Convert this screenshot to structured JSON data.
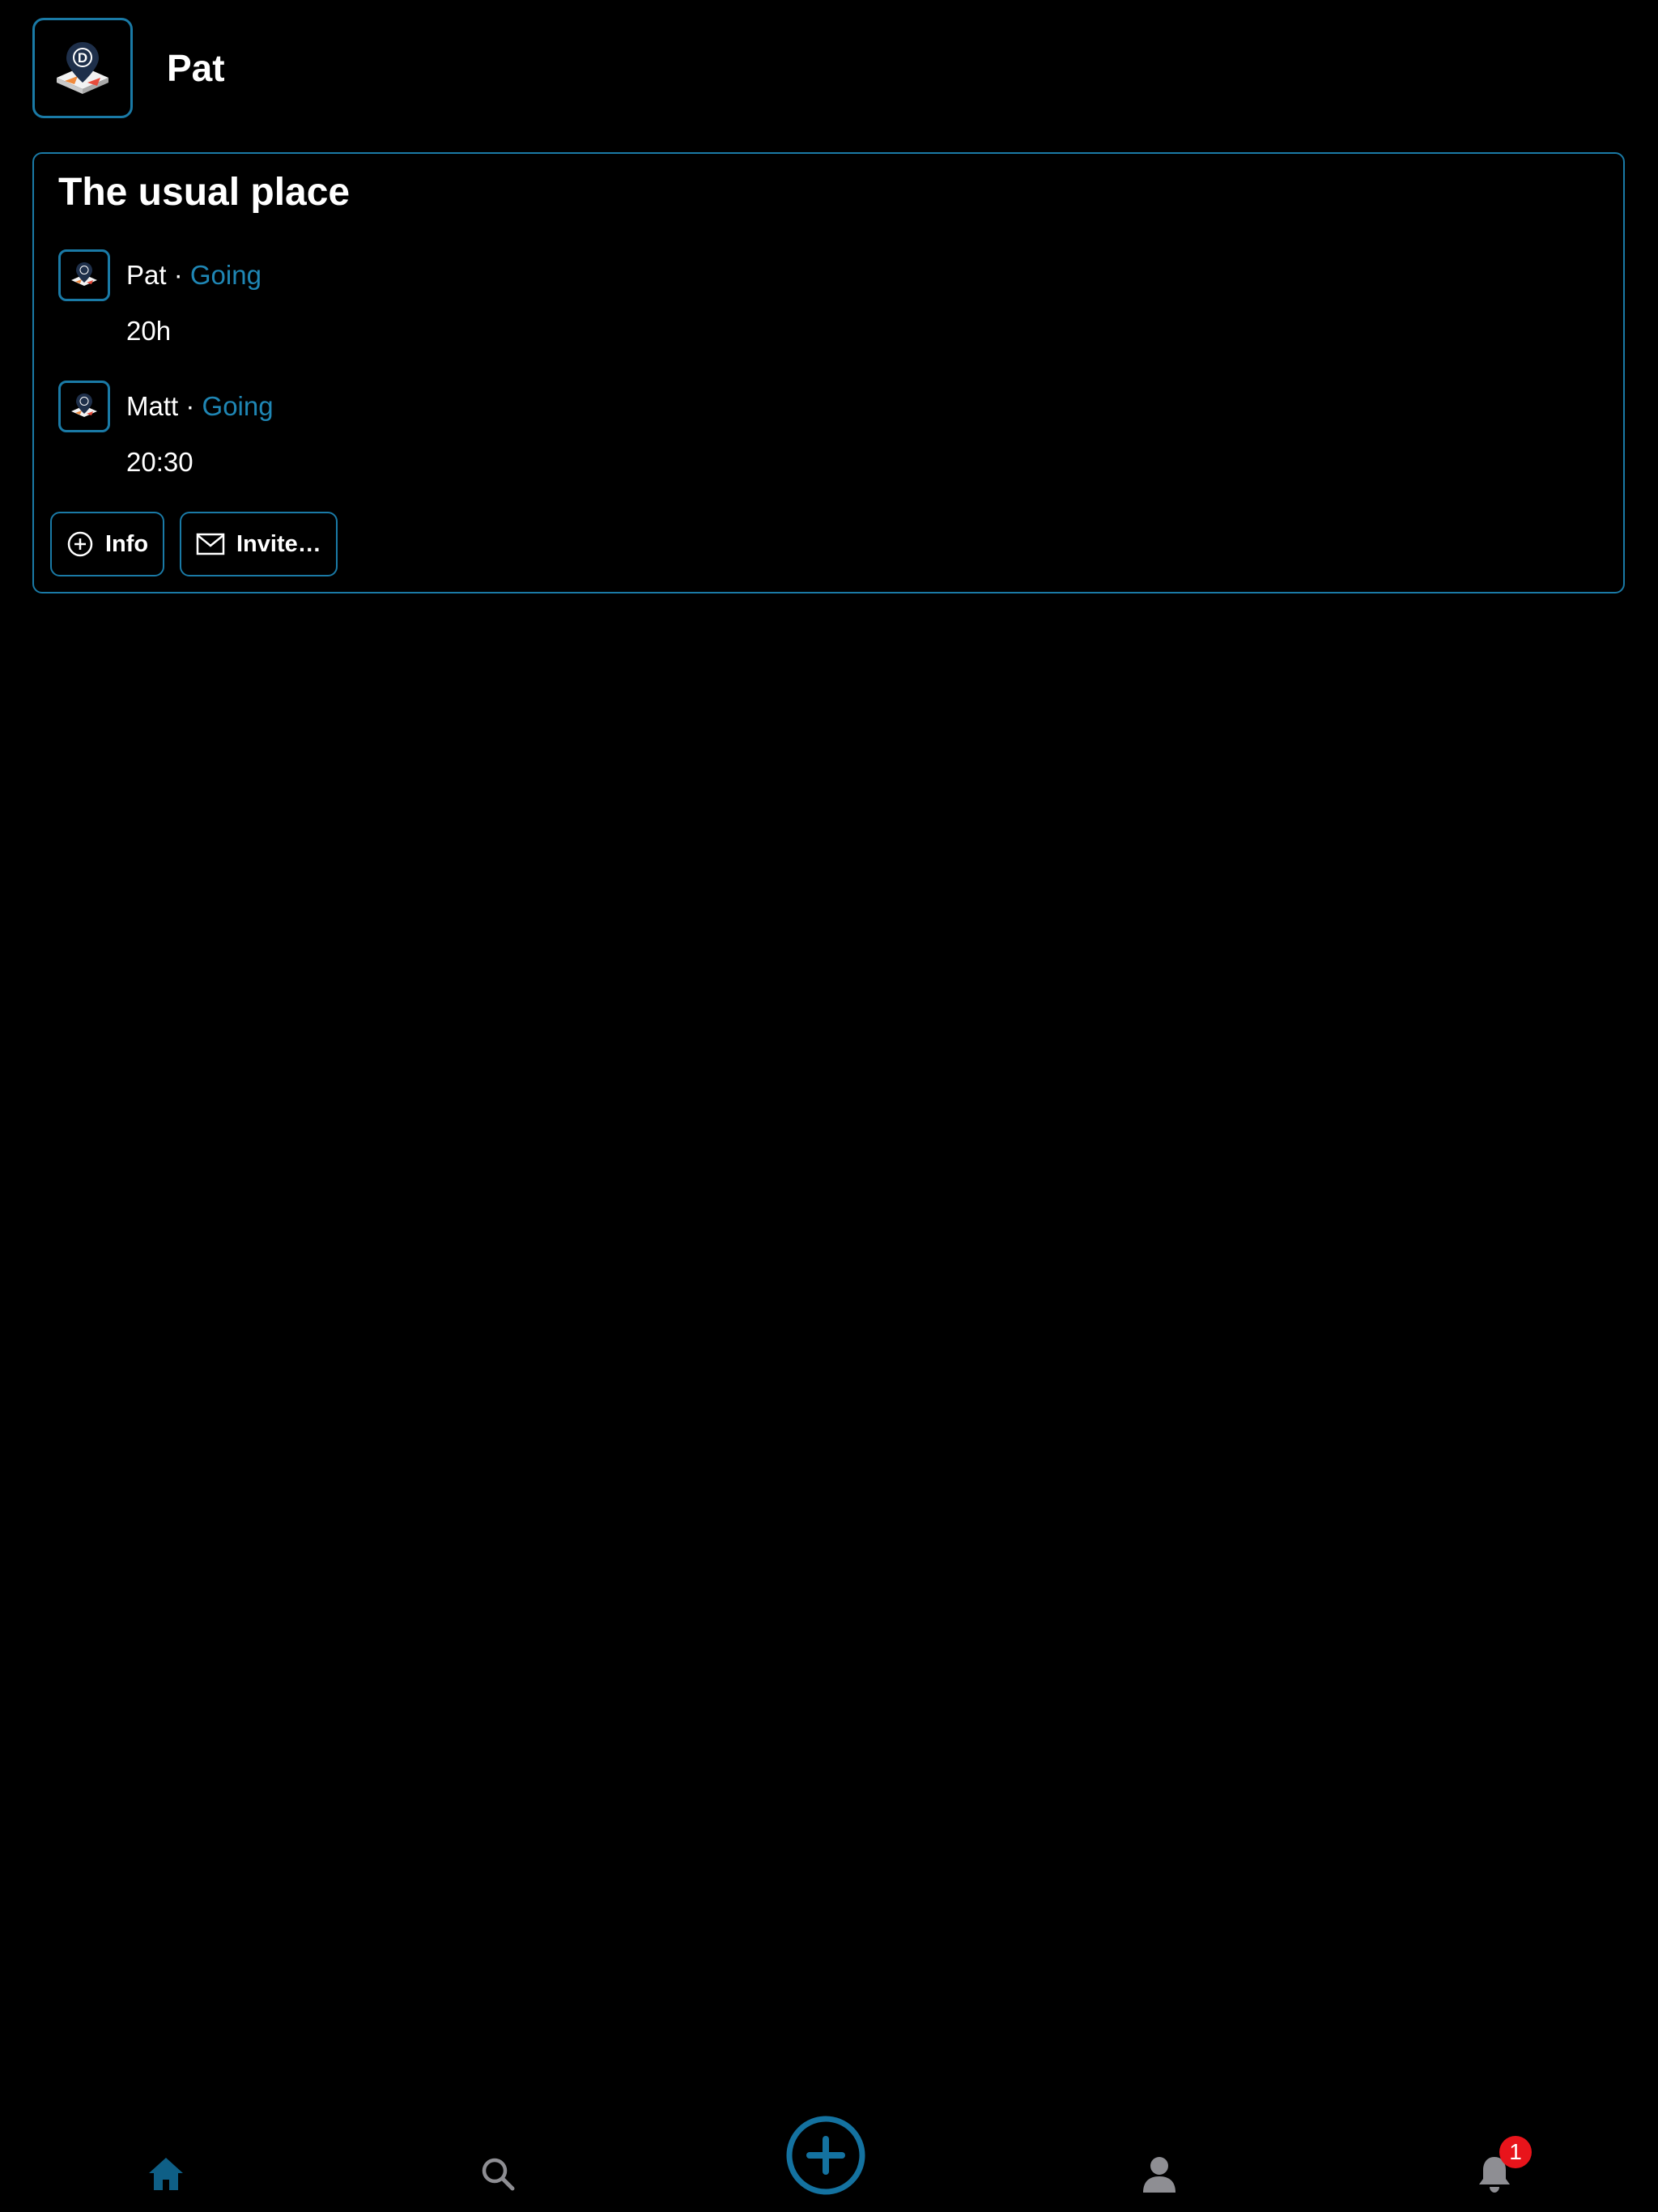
{
  "header": {
    "user_name": "Pat",
    "avatar_icon": "map-pin-logo-icon"
  },
  "event": {
    "title": "The usual place",
    "attendees": [
      {
        "name": "Pat",
        "separator": "·",
        "status": "Going",
        "time": "20h"
      },
      {
        "name": "Matt",
        "separator": "·",
        "status": "Going",
        "time": "20:30"
      }
    ],
    "buttons": {
      "info_label": "Info",
      "invite_label": "Invite…"
    }
  },
  "nav": {
    "items": [
      "home-icon",
      "search-icon",
      "add-circle-icon",
      "profile-icon",
      "bell-icon"
    ],
    "notification_count": "1"
  },
  "colors": {
    "accent": "#1a7aa6",
    "status": "#1f86b4",
    "badge": "#e8141b",
    "inactive_icon": "#8e8e93",
    "background": "#000000"
  }
}
